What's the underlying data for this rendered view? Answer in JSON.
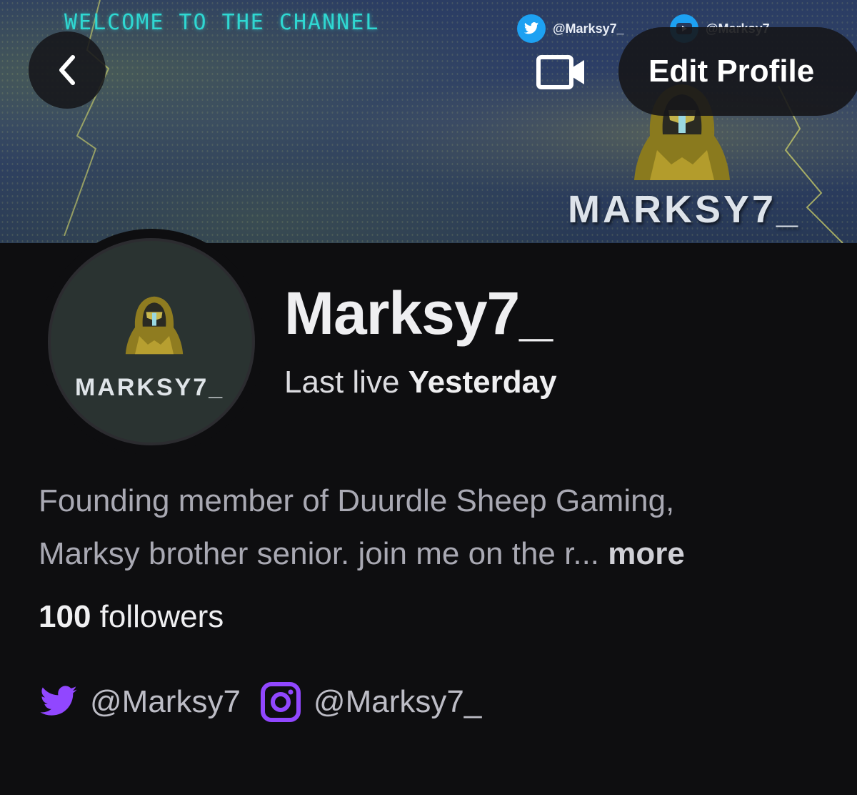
{
  "banner": {
    "welcome_text": "WELCOME TO THE CHANNEL",
    "twitter_handle": "@Marksy7_",
    "youtube_handle": "@Marksy7",
    "logo_text": "MARKSY7_"
  },
  "header": {
    "back_icon": "chevron-left-icon",
    "video_icon": "video-camera-icon",
    "edit_profile_label": "Edit Profile"
  },
  "avatar": {
    "logo_text": "MARKSY7_"
  },
  "profile": {
    "username": "Marksy7_",
    "last_live_label": "Last live",
    "last_live_value": "Yesterday",
    "bio_line1": "Founding member of Duurdle Sheep Gaming,",
    "bio_line2": "Marksy brother senior. join me on the r...",
    "bio_more": "more",
    "followers_count": "100",
    "followers_label": "followers"
  },
  "socials": [
    {
      "icon": "twitter-icon",
      "handle": "@Marksy7"
    },
    {
      "icon": "instagram-icon",
      "handle": "@Marksy7_"
    }
  ],
  "colors": {
    "background": "#0e0e10",
    "accent_purple": "#9147ff",
    "banner_blue": "#2e4068",
    "banner_cyan": "#2fd8d2"
  }
}
